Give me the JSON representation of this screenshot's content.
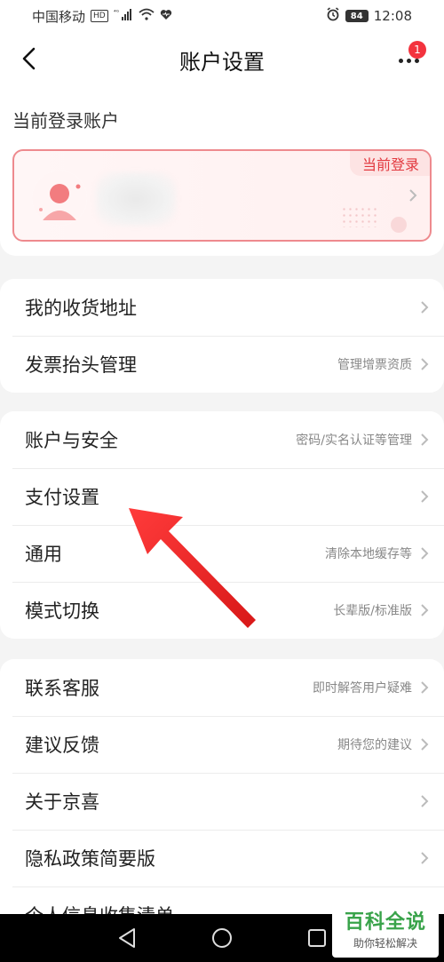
{
  "status_bar": {
    "carrier": "中国移动",
    "hd": "HD",
    "signal": "⁴ᴳ",
    "battery": "84",
    "time": "12:08"
  },
  "nav": {
    "title": "账户设置",
    "badge_count": "1"
  },
  "account": {
    "section_label": "当前登录账户",
    "current_tag": "当前登录"
  },
  "groups": [
    {
      "rows": [
        {
          "label": "我的收货地址",
          "sub": ""
        },
        {
          "label": "发票抬头管理",
          "sub": "管理增票资质"
        }
      ]
    },
    {
      "rows": [
        {
          "label": "账户与安全",
          "sub": "密码/实名认证等管理"
        },
        {
          "label": "支付设置",
          "sub": ""
        },
        {
          "label": "通用",
          "sub": "清除本地缓存等"
        },
        {
          "label": "模式切换",
          "sub": "长辈版/标准版"
        }
      ]
    },
    {
      "rows": [
        {
          "label": "联系客服",
          "sub": "即时解答用户疑难"
        },
        {
          "label": "建议反馈",
          "sub": "期待您的建议"
        },
        {
          "label": "关于京喜",
          "sub": ""
        },
        {
          "label": "隐私政策简要版",
          "sub": ""
        },
        {
          "label": "个人信息收集清单",
          "sub": ""
        }
      ]
    }
  ],
  "watermark": {
    "main": "百科全说",
    "sub": "助你轻松解决"
  },
  "colors": {
    "accent": "#e2393f",
    "card_border": "#ee8a8e",
    "arrow": "#ee2a2a"
  }
}
